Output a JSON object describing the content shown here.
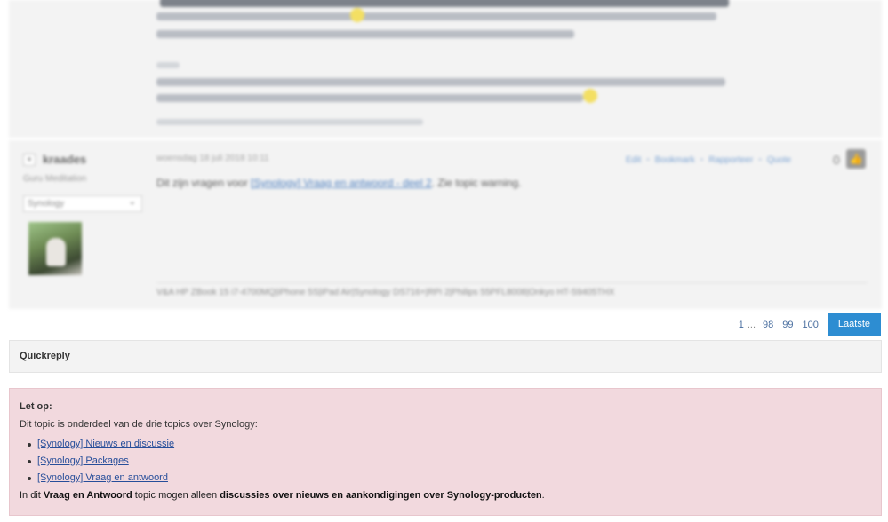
{
  "post": {
    "author": "kraades",
    "rank": "Guru Meditation",
    "platform_select": "Synology",
    "date": "woensdag 18 juli 2018 10:11",
    "text_before": "Dit zijn vragen voor ",
    "text_link": "[Synology] Vraag en antwoord - deel 2",
    "text_after": ". Zie topic warning.",
    "actions": [
      "Edit",
      "Bookmark",
      "Rapporteer",
      "Quote"
    ],
    "score": "0",
    "signature": "V&A HP ZBook 15 i7-4700MQ|iPhone 5S|iPad Air|Synology DS716+|RPi 2|Philips 55PFL8008|Onkyo HT-S9405THX"
  },
  "pagination": {
    "pages": [
      "1",
      "98",
      "99",
      "100"
    ],
    "ellipsis": "...",
    "last": "Laatste"
  },
  "quickreply": {
    "label": "Quickreply"
  },
  "notice": {
    "title": "Let op:",
    "intro": "Dit topic is onderdeel van de drie topics over Synology:",
    "links": [
      "[Synology] Nieuws en discussie",
      "[Synology] Packages",
      "[Synology] Vraag en antwoord"
    ],
    "footer_1": "In dit ",
    "footer_b1": "Vraag en Antwoord",
    "footer_2": " topic mogen alleen ",
    "footer_b2": "discussies over nieuws en aankondigingen over Synology-producten",
    "footer_3": "."
  }
}
